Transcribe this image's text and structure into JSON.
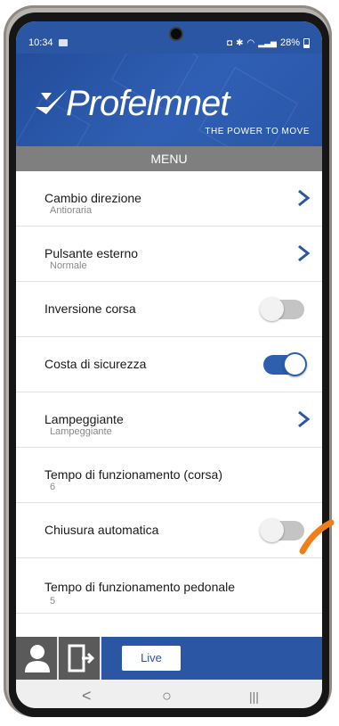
{
  "status_bar": {
    "time": "10:34",
    "battery": "28%"
  },
  "header": {
    "brand": "Profelmnet",
    "tagline": "THE POWER TO MOVE"
  },
  "menu_title": "MENU",
  "settings": [
    {
      "title": "Cambio direzione",
      "subtitle": "Antioraria",
      "control": "chevron"
    },
    {
      "title": "Pulsante esterno",
      "subtitle": "Normale",
      "control": "chevron"
    },
    {
      "title": "Inversione corsa",
      "subtitle": "",
      "control": "toggle",
      "enabled": false
    },
    {
      "title": "Costa di sicurezza",
      "subtitle": "",
      "control": "toggle",
      "enabled": true
    },
    {
      "title": "Lampeggiante",
      "subtitle": "Lampeggiante",
      "control": "chevron"
    },
    {
      "title": "Tempo di funzionamento (corsa)",
      "subtitle": "6",
      "control": "none"
    },
    {
      "title": "Chiusura automatica",
      "subtitle": "",
      "control": "toggle",
      "enabled": false
    },
    {
      "title": "Tempo di funzionamento pedonale",
      "subtitle": "5",
      "control": "none"
    }
  ],
  "bottom_bar": {
    "live_label": "Live",
    "icons": [
      "user-icon",
      "logout-icon"
    ]
  },
  "nav_bar": {
    "back": "<",
    "home": "○",
    "recents": "|||"
  },
  "colors": {
    "brand_blue": "#2b56a4",
    "menu_gray": "#7f7f7f",
    "toggle_on": "#2e5fae",
    "gesture_orange": "#ef7f1a"
  }
}
